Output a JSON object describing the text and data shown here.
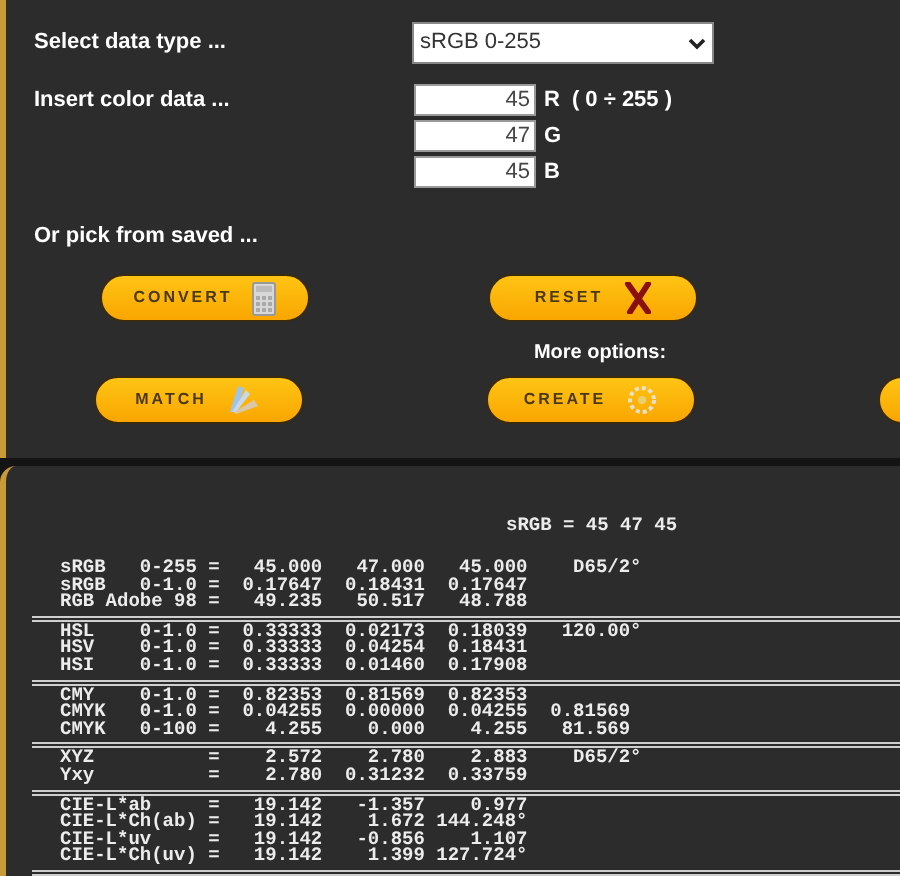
{
  "form": {
    "data_type": {
      "label": "Select data type ...",
      "value": "sRGB 0-255"
    },
    "color_data": {
      "label": "Insert color data ...",
      "channels": [
        {
          "value": "45",
          "channel": "R",
          "range": "( 0 ÷ 255 )"
        },
        {
          "value": "47",
          "channel": "G"
        },
        {
          "value": "45",
          "channel": "B"
        }
      ]
    },
    "saved_label": "Or pick from saved ..."
  },
  "buttons_row1": [
    {
      "label": "CONVERT"
    },
    {
      "label": "RESET"
    }
  ],
  "more_options": "More options:",
  "buttons_row2": [
    {
      "label": "MATCH"
    },
    {
      "label": "CREATE"
    }
  ],
  "output": {
    "header": "sRGB = 45 47 45",
    "groups": [
      {
        "lines": [
          "sRGB   0-255 =   45.000   47.000   45.000    D65/2°",
          "sRGB   0-1.0 =  0.17647  0.18431  0.17647",
          "RGB Adobe 98 =   49.235   50.517   48.788"
        ]
      },
      {
        "lines": [
          "HSL    0-1.0 =  0.33333  0.02173  0.18039   120.00°",
          "HSV    0-1.0 =  0.33333  0.04254  0.18431",
          "HSI    0-1.0 =  0.33333  0.01460  0.17908"
        ]
      },
      {
        "lines": [
          "CMY    0-1.0 =  0.82353  0.81569  0.82353",
          "CMYK   0-1.0 =  0.04255  0.00000  0.04255  0.81569",
          "CMYK   0-100 =    4.255    0.000    4.255   81.569"
        ]
      },
      {
        "lines": [
          "XYZ          =    2.572    2.780    2.883    D65/2°",
          "Yxy          =    2.780  0.31232  0.33759"
        ]
      },
      {
        "lines": [
          "CIE-L*ab     =   19.142   -1.357    0.977",
          "CIE-L*Ch(ab) =   19.142    1.672 144.248°",
          "CIE-L*uv     =   19.142   -0.856    1.107",
          "CIE-L*Ch(uv) =   19.142    1.399 127.724°"
        ]
      }
    ]
  }
}
